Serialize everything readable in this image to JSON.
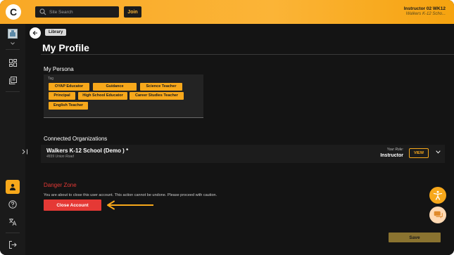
{
  "header": {
    "logo_text": "C",
    "search": {
      "placeholder": "Site Search"
    },
    "join_label": "Join",
    "user_name": "Instructor 02 WK12",
    "user_org": "Walkers K-12 Scho..."
  },
  "breadcrumb": {
    "label": "Library"
  },
  "page": {
    "title": "My Profile"
  },
  "persona": {
    "section_title": "My Persona",
    "tag_label": "Tag",
    "tags": [
      "OYAP Educator",
      "Guidance Counsellor",
      "Science Teacher",
      "Principal",
      "High School Educator",
      "Career Studies Teacher",
      "English Teacher"
    ]
  },
  "organizations": {
    "section_title": "Connected Organizations",
    "items": [
      {
        "name": "Walkers K-12 School (Demo ) *",
        "address": "4839 Union Road",
        "role_label": "Your Role:",
        "role": "Instructor",
        "view_label": "VIEW"
      }
    ]
  },
  "danger": {
    "title": "Danger Zone",
    "message": "You are about to close this user account. This action cannot be undone. Please proceed with caution.",
    "close_label": "Close Account"
  },
  "save_label": "Save",
  "colors": {
    "accent": "#f7a81b",
    "danger": "#e53935",
    "background": "#141414",
    "panel": "#1c1c1c"
  },
  "icons": {
    "sidebar": [
      "org-avatar-icon",
      "dashboard-icon",
      "library-icon",
      "collapse-icon",
      "profile-icon",
      "help-icon",
      "translate-icon",
      "logout-icon"
    ],
    "floating": [
      "accessibility-icon",
      "chat-icon"
    ]
  }
}
